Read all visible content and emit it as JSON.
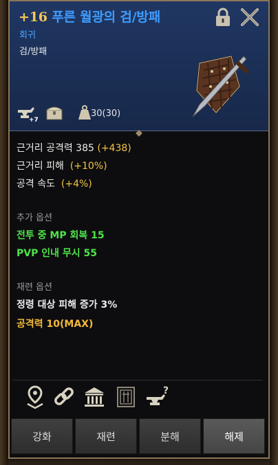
{
  "item": {
    "enhancement": "+16",
    "name": "푸른 월광의 검/방패",
    "grade": "회귀",
    "type": "검/방패",
    "weight": "30(30)",
    "enchant_badge": "7"
  },
  "stats": {
    "melee_attack_label": "근거리 공격력 385",
    "melee_attack_bonus": "(+438)",
    "melee_damage_label": "근거리 피해",
    "melee_damage_bonus": "(+10%)",
    "attack_speed_label": "공격 속도",
    "attack_speed_bonus": "(+4%)"
  },
  "additional_options": {
    "header": "추가 옵션",
    "lines": [
      "전투 중 MP 회복 15",
      "PVP 인내 무시 55"
    ]
  },
  "reforge_options": {
    "header": "재련 옵션",
    "line1": "정령 대상 피해 증가 3%",
    "line2": "공격력 10(MAX)"
  },
  "buttons": {
    "enhance": "강화",
    "reforge": "재련",
    "disassemble": "분해",
    "release": "해제"
  },
  "icons": {
    "header": [
      "enchant-anvil-icon",
      "chest-icon",
      "weight-icon"
    ],
    "bottom": [
      "location-pin-icon",
      "chain-link-icon",
      "bank-icon",
      "tradepost-icon",
      "enchant-unknown-icon"
    ],
    "top": [
      "lock-icon",
      "close-icon"
    ]
  },
  "colors": {
    "title": "#3f9cff",
    "enhancement": "#f5c65a",
    "bonus": "#f3c545",
    "green_option": "#4fe34a",
    "header_bg": "#1b2f55"
  }
}
